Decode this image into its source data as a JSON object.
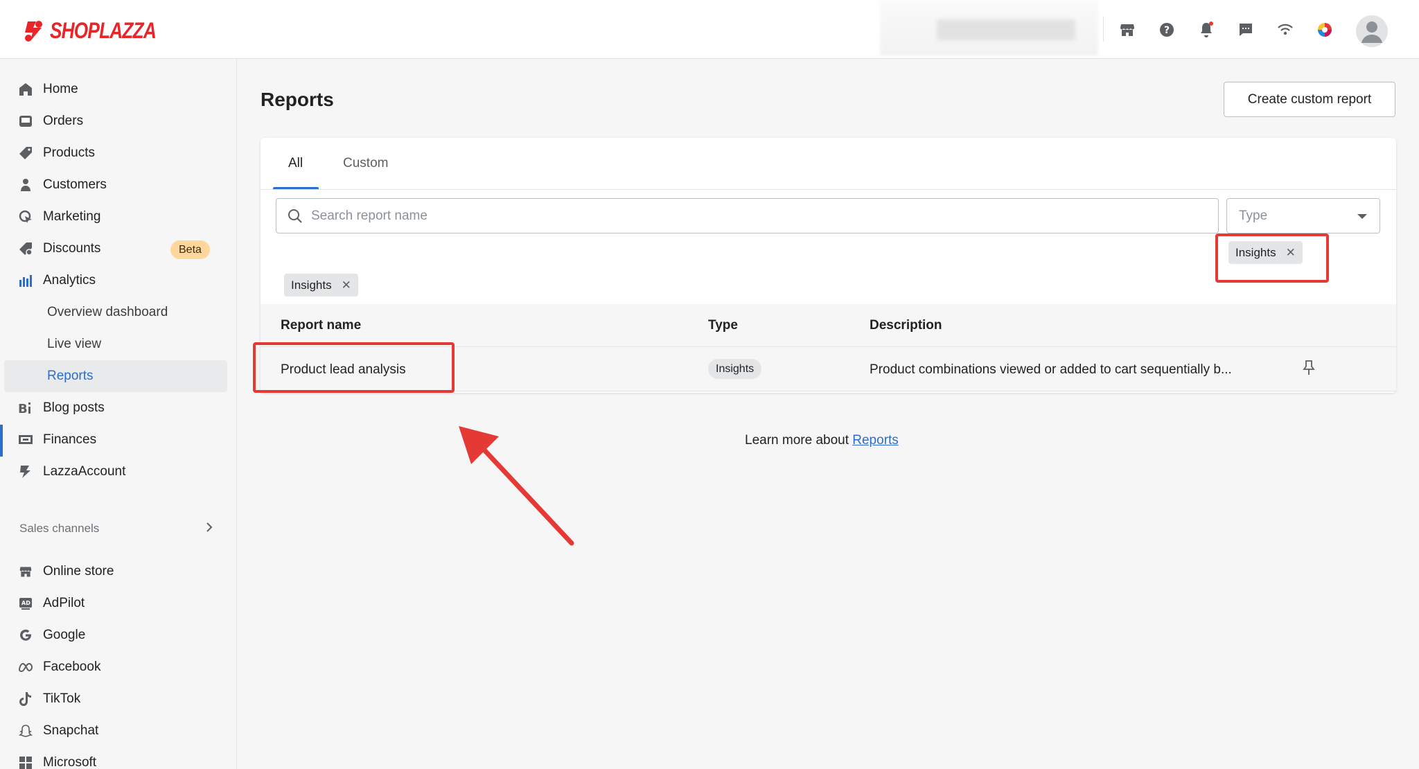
{
  "brand": {
    "name": "SHOPLAZZA",
    "color": "#e8262a"
  },
  "topbar": {
    "icons": [
      "store-icon",
      "help-icon",
      "bell-icon",
      "chat-icon",
      "wifi-icon",
      "color-wheel-icon"
    ]
  },
  "sidebar": {
    "items": [
      {
        "label": "Home",
        "icon": "home-icon"
      },
      {
        "label": "Orders",
        "icon": "orders-icon"
      },
      {
        "label": "Products",
        "icon": "tag-icon"
      },
      {
        "label": "Customers",
        "icon": "person-icon"
      },
      {
        "label": "Marketing",
        "icon": "marketing-icon"
      },
      {
        "label": "Discounts",
        "icon": "discount-icon",
        "badge": "Beta"
      },
      {
        "label": "Analytics",
        "icon": "analytics-icon"
      },
      {
        "label": "Overview dashboard"
      },
      {
        "label": "Live view"
      },
      {
        "label": "Reports"
      },
      {
        "label": "Blog posts",
        "icon": "blog-icon"
      },
      {
        "label": "Finances",
        "icon": "finances-icon"
      },
      {
        "label": "LazzaAccount",
        "icon": "lazza-icon"
      }
    ],
    "sales_channels_title": "Sales channels",
    "channels": [
      {
        "label": "Online store",
        "icon": "store-icon"
      },
      {
        "label": "AdPilot",
        "icon": "ad-icon"
      },
      {
        "label": "Google",
        "icon": "google-icon"
      },
      {
        "label": "Facebook",
        "icon": "meta-icon"
      },
      {
        "label": "TikTok",
        "icon": "tiktok-icon"
      },
      {
        "label": "Snapchat",
        "icon": "snapchat-icon"
      },
      {
        "label": "Microsoft",
        "icon": "microsoft-icon"
      }
    ]
  },
  "main": {
    "title": "Reports",
    "create_button": "Create custom report",
    "tabs": [
      {
        "label": "All",
        "selected": true
      },
      {
        "label": "Custom"
      }
    ],
    "search": {
      "placeholder": "Search report name",
      "value": ""
    },
    "type_select": {
      "placeholder": "Type",
      "option_chip": "Insights"
    },
    "applied_filter": "Insights",
    "table": {
      "columns": [
        "Report name",
        "Type",
        "Description"
      ],
      "rows": [
        {
          "name": "Product lead analysis",
          "type": "Insights",
          "description": "Product combinations viewed or added to cart sequentially b..."
        }
      ]
    },
    "learn_more": {
      "prefix": "Learn more about ",
      "link": "Reports"
    }
  },
  "colors": {
    "accent": "#2c6ecb",
    "annotation": "#e53935",
    "beta_badge": "#ffd79d"
  }
}
